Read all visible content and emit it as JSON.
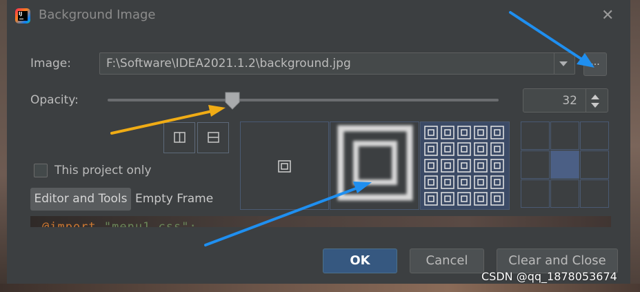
{
  "dialog": {
    "title": "Background Image",
    "close_icon": "close-icon",
    "app_icon": "intellij-idea-icon"
  },
  "image_field": {
    "label": "Image:",
    "value": "F:\\Software\\IDEA2021.1.2\\background.jpg",
    "browse_label": "..."
  },
  "opacity": {
    "label": "Opacity:",
    "value": "32",
    "slider_fraction": 0.32
  },
  "options": {
    "this_project_only": "This project only",
    "checked": false
  },
  "tabs": [
    {
      "label": "Editor and Tools",
      "active": true
    },
    {
      "label": "Empty Frame",
      "active": false
    }
  ],
  "fill_modes": [
    "scale",
    "center",
    "tile"
  ],
  "anchor_grid": {
    "selected": "center"
  },
  "preview_code": {
    "keyword": "@import",
    "string": "\"menu1.css\";"
  },
  "buttons": {
    "ok": "OK",
    "cancel": "Cancel",
    "clear_and_close": "Clear and Close"
  },
  "watermark": "CSDN @qq_1878053674",
  "colors": {
    "accent": "#365880",
    "annotation_arrow_yellow": "#f0ac15",
    "annotation_arrow_blue": "#1f8ff0",
    "anchor_selected": "#4b5f85"
  }
}
